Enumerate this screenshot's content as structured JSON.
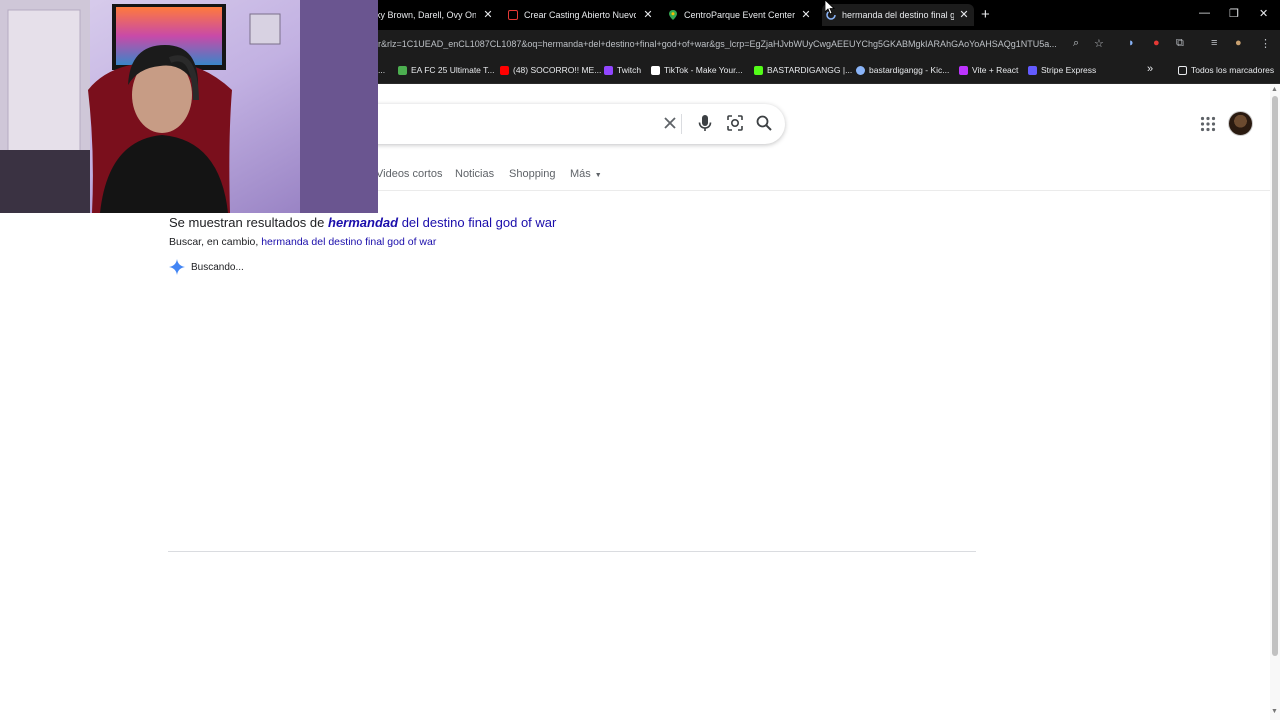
{
  "browser": {
    "tabs": [
      {
        "title": "ky Brown, Darell, Ovy On Th",
        "favicon_color": "#e8eaed"
      },
      {
        "title": "Crear Casting Abierto Nuevo Re",
        "favicon_color": "#e53935"
      },
      {
        "title": "CentroParque Event Center - G",
        "favicon_color": "#34a853"
      },
      {
        "title": "hermanda del destino final god",
        "favicon_color": "#8ab4f8",
        "active": true
      }
    ],
    "url": "r&rlz=1C1UEAD_enCL1087CL1087&oq=hermanda+del+destino+final+god+of+war&gs_lcrp=EgZjaHJvbWUyCwgAEEUYChg5GKABMgkIARAhGAoYoAHSAQg1NTU5a...",
    "bookmarks": [
      {
        "label": "...",
        "color": "#9aa0a6"
      },
      {
        "label": "EA FC 25 Ultimate T...",
        "color": "#4caf50"
      },
      {
        "label": "(48) SOCORRO!! ME...",
        "color": "#ff0000"
      },
      {
        "label": "Twitch",
        "color": "#9146ff"
      },
      {
        "label": "TikTok - Make Your...",
        "color": "#ffffff"
      },
      {
        "label": "BASTARDIGANGG |...",
        "color": "#53fc18"
      },
      {
        "label": "bastardigangg - Kic...",
        "color": "#8ab4f8"
      },
      {
        "label": "Vite + React",
        "color": "#bd34fe"
      },
      {
        "label": "Stripe Express",
        "color": "#635bff"
      }
    ],
    "all_bookmarks": "Todos los marcadores"
  },
  "search": {
    "nav": [
      "Videos cortos",
      "Noticias",
      "Shopping",
      "Más"
    ],
    "correction_prefix": "Se muestran resultados de",
    "correction_bold": "hermandad",
    "correction_rest": "del destino final god of war",
    "alt_prefix": "Buscar, en cambio,",
    "alt_link": "hermanda del destino final god of war",
    "loading": "Buscando..."
  },
  "colors": {
    "link": "#1a0dab",
    "chrome_bg": "#000000",
    "toolbar_bg": "#1c1c1c"
  }
}
